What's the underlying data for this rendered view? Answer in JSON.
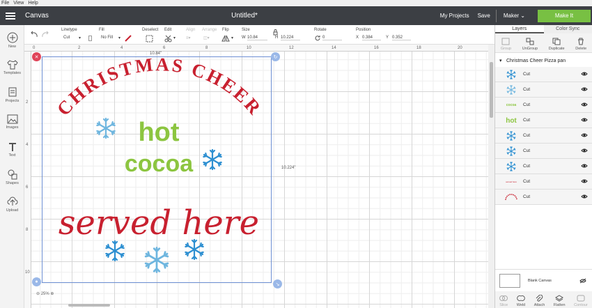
{
  "menubar": {
    "file": "File",
    "view": "View",
    "help": "Help"
  },
  "header": {
    "canvas_label": "Canvas",
    "doc_title": "Untitled*",
    "my_projects": "My Projects",
    "save": "Save",
    "machine": "Maker",
    "make_it": "Make It"
  },
  "toolbar": {
    "linetype_label": "Linetype",
    "linetype_value": "Cut",
    "fill_label": "Fill",
    "fill_value": "No Fill",
    "deselect_label": "Deselect",
    "edit_label": "Edit",
    "align_label": "Align",
    "arrange_label": "Arrange",
    "flip_label": "Flip",
    "size_label": "Size",
    "w_label": "W",
    "w_value": "10.84",
    "h_label": "H",
    "h_value": "10.224",
    "rotate_label": "Rotate",
    "rotate_value": "0",
    "position_label": "Position",
    "x_label": "X",
    "x_value": "0.384",
    "y_label": "Y",
    "y_value": "0.352"
  },
  "sidebar": [
    {
      "label": "New",
      "icon": "plus-icon"
    },
    {
      "label": "Templates",
      "icon": "shirt-icon"
    },
    {
      "label": "Projects",
      "icon": "projects-icon"
    },
    {
      "label": "Images",
      "icon": "image-icon"
    },
    {
      "label": "Text",
      "icon": "text-icon"
    },
    {
      "label": "Shapes",
      "icon": "shapes-icon"
    },
    {
      "label": "Upload",
      "icon": "upload-icon"
    }
  ],
  "ruler": {
    "top": [
      "0",
      "2",
      "4",
      "6",
      "8",
      "10",
      "12",
      "14",
      "16",
      "18",
      "20"
    ],
    "left": [
      "2",
      "4",
      "6",
      "8",
      "10"
    ]
  },
  "canvas": {
    "width_dim": "10.84\"",
    "height_dim": "10.224\"",
    "zoom": "25%",
    "art": {
      "arc_text": "CHRISTMAS CHEER",
      "hot": "hot",
      "cocoa": "cocoa",
      "served": "served here"
    }
  },
  "colors": {
    "red": "#c8202f",
    "green": "#8cc540",
    "blue": "#2d8fd1",
    "lightblue": "#6fb6df",
    "accent": "#78c043",
    "header": "#3c3f44"
  },
  "panel": {
    "tabs": [
      "Layers",
      "Color Sync"
    ],
    "actions": [
      "Group",
      "UnGroup",
      "Duplicate",
      "Delete"
    ],
    "group_name": "Christmas Cheer Pizza pan",
    "layers": [
      {
        "name": "Cut",
        "thumb": "snowflake-blue"
      },
      {
        "name": "Cut",
        "thumb": "snowflake-light"
      },
      {
        "name": "Cut",
        "thumb": "cocoa-text"
      },
      {
        "name": "Cut",
        "thumb": "hot-text"
      },
      {
        "name": "Cut",
        "thumb": "snowflake-blue"
      },
      {
        "name": "Cut",
        "thumb": "snowflake-blue"
      },
      {
        "name": "Cut",
        "thumb": "snowflake-blue"
      },
      {
        "name": "Cut",
        "thumb": "served-text"
      },
      {
        "name": "Cut",
        "thumb": "arc-text"
      }
    ],
    "blank_canvas": "Blank Canvas",
    "bottom_actions": [
      "Slice",
      "Weld",
      "Attach",
      "Flatten",
      "Contour"
    ]
  }
}
